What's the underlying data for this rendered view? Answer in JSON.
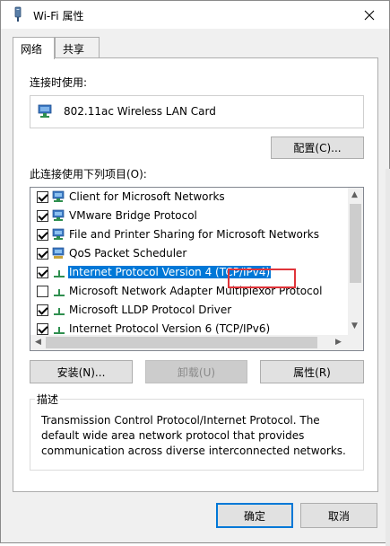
{
  "window": {
    "title": "Wi-Fi 属性",
    "close_glyph": "✕"
  },
  "tabs": [
    {
      "label": "网络",
      "active": true
    },
    {
      "label": "共享",
      "active": false
    }
  ],
  "connect_using": {
    "label": "连接时使用:",
    "adapter_name": "802.11ac Wireless LAN Card"
  },
  "configure_button": "配置(C)...",
  "items_label": "此连接使用下列项目(O):",
  "items": [
    {
      "label": "Client for Microsoft Networks",
      "checked": true,
      "icon": "network-client-icon"
    },
    {
      "label": "VMware Bridge Protocol",
      "checked": true,
      "icon": "network-client-icon"
    },
    {
      "label": "File and Printer Sharing for Microsoft Networks",
      "checked": true,
      "icon": "network-client-icon"
    },
    {
      "label": "QoS Packet Scheduler",
      "checked": true,
      "icon": "network-service-icon"
    },
    {
      "label": "Internet Protocol Version 4 (TCP/IPv4)",
      "checked": true,
      "icon": "protocol-icon",
      "selected": true
    },
    {
      "label": "Microsoft Network Adapter Multiplexor Protocol",
      "checked": false,
      "icon": "protocol-icon"
    },
    {
      "label": "Microsoft LLDP Protocol Driver",
      "checked": true,
      "icon": "protocol-icon"
    },
    {
      "label": "Internet Protocol Version 6 (TCP/IPv6)",
      "checked": true,
      "icon": "protocol-icon"
    }
  ],
  "buttons": {
    "install": "安装(N)...",
    "uninstall": "卸载(U)",
    "properties": "属性(R)"
  },
  "description": {
    "legend": "描述",
    "text": "Transmission Control Protocol/Internet Protocol. The default wide area network protocol that provides communication across diverse interconnected networks."
  },
  "footer": {
    "ok": "确定",
    "cancel": "取消"
  },
  "colors": {
    "selection": "#0078d7",
    "annotation": "#e0343a"
  }
}
